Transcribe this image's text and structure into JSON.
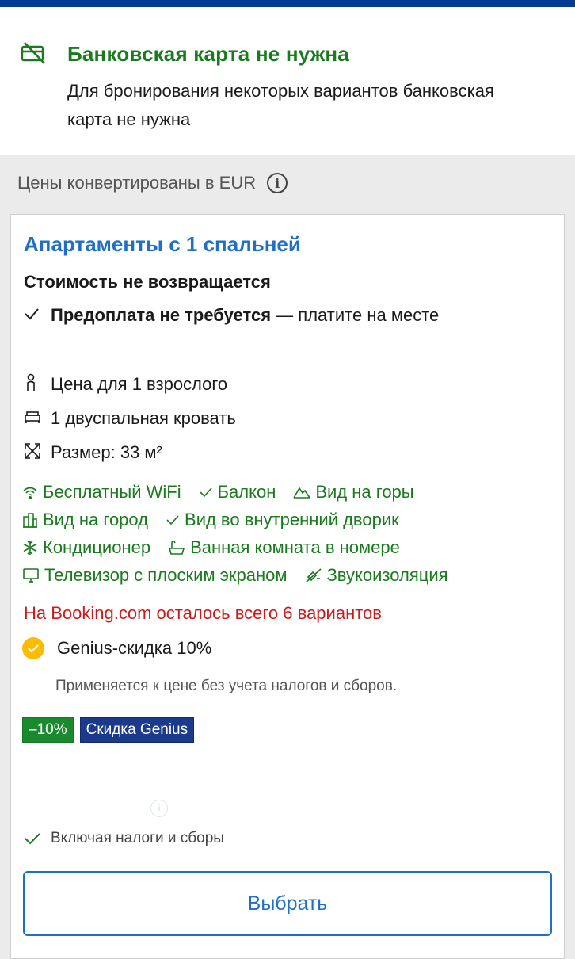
{
  "banner": {
    "title": "Банковская карта не нужна",
    "text": "Для бронирования некоторых вариантов банковская карта не нужна",
    "icon": "no-credit-card-icon"
  },
  "converted_note": "Цены конвертированы в EUR",
  "room": {
    "title": "Апартаменты с 1 спальней",
    "policy": "Стоимость не возвращается",
    "prepayment_bold": "Предоплата не требуется",
    "prepayment_rest": " — платите на месте",
    "price_for": "Цена для 1 взрослого",
    "bed": "1 двуспальная кровать",
    "size": "Размер: 33 м²",
    "facilities": [
      [
        "Бесплатный WiFi",
        "Балкон",
        "Вид на горы"
      ],
      [
        "Вид на город",
        "Вид во внутренний дворик"
      ],
      [
        "Кондиционер",
        "Ванная комната в номере"
      ],
      [
        "Телевизор с плоским экраном",
        "Звукоизоляция"
      ]
    ],
    "availability_warning": "На Booking.com осталось всего 6 вариантов",
    "genius_discount": "Genius-скидка 10%",
    "genius_note": "Применяется к цене без учета налогов и сборов.",
    "badge_discount": "–10%",
    "badge_genius": "Скидка Genius",
    "taxes_note": "Включая налоги и сборы",
    "select_button": "Выбрать"
  },
  "colors": {
    "brand_blue": "#003b95",
    "link_blue": "#1f6fc5",
    "green": "#1a7a1e",
    "warning_red": "#cc1a1a",
    "genius_yellow": "#febb02"
  }
}
